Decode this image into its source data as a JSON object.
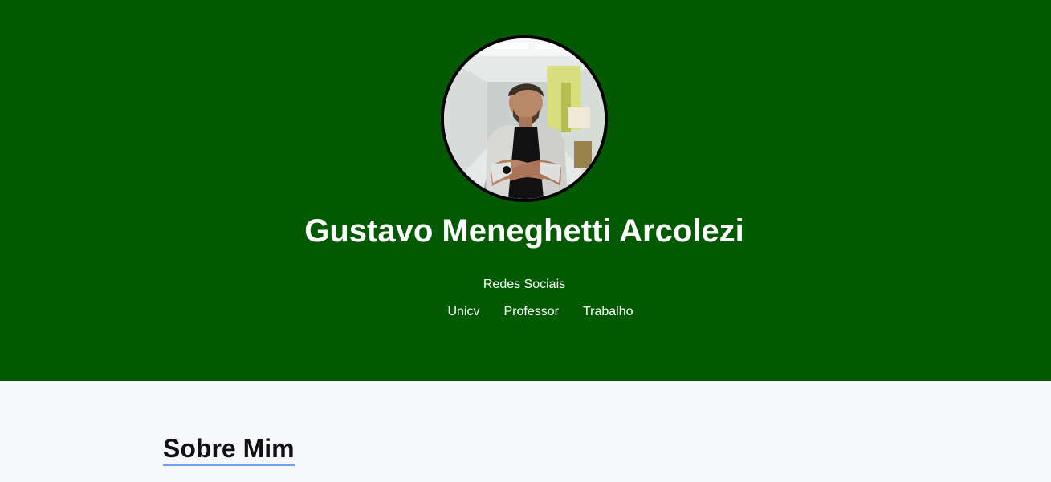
{
  "header": {
    "avatar_alt": "Gustavo Meneghetti Arcolezi",
    "name": "Gustavo Meneghetti Arcolezi",
    "social_title": "Redes Sociais",
    "links": [
      {
        "label": "Unicv"
      },
      {
        "label": "Professor"
      },
      {
        "label": "Trabalho"
      }
    ]
  },
  "about": {
    "title": "Sobre Mim"
  },
  "colors": {
    "header_background": "#035a02",
    "page_background": "#f7f8fc",
    "heading_underline": "#6ea2e8",
    "avatar_border": "#000000"
  }
}
